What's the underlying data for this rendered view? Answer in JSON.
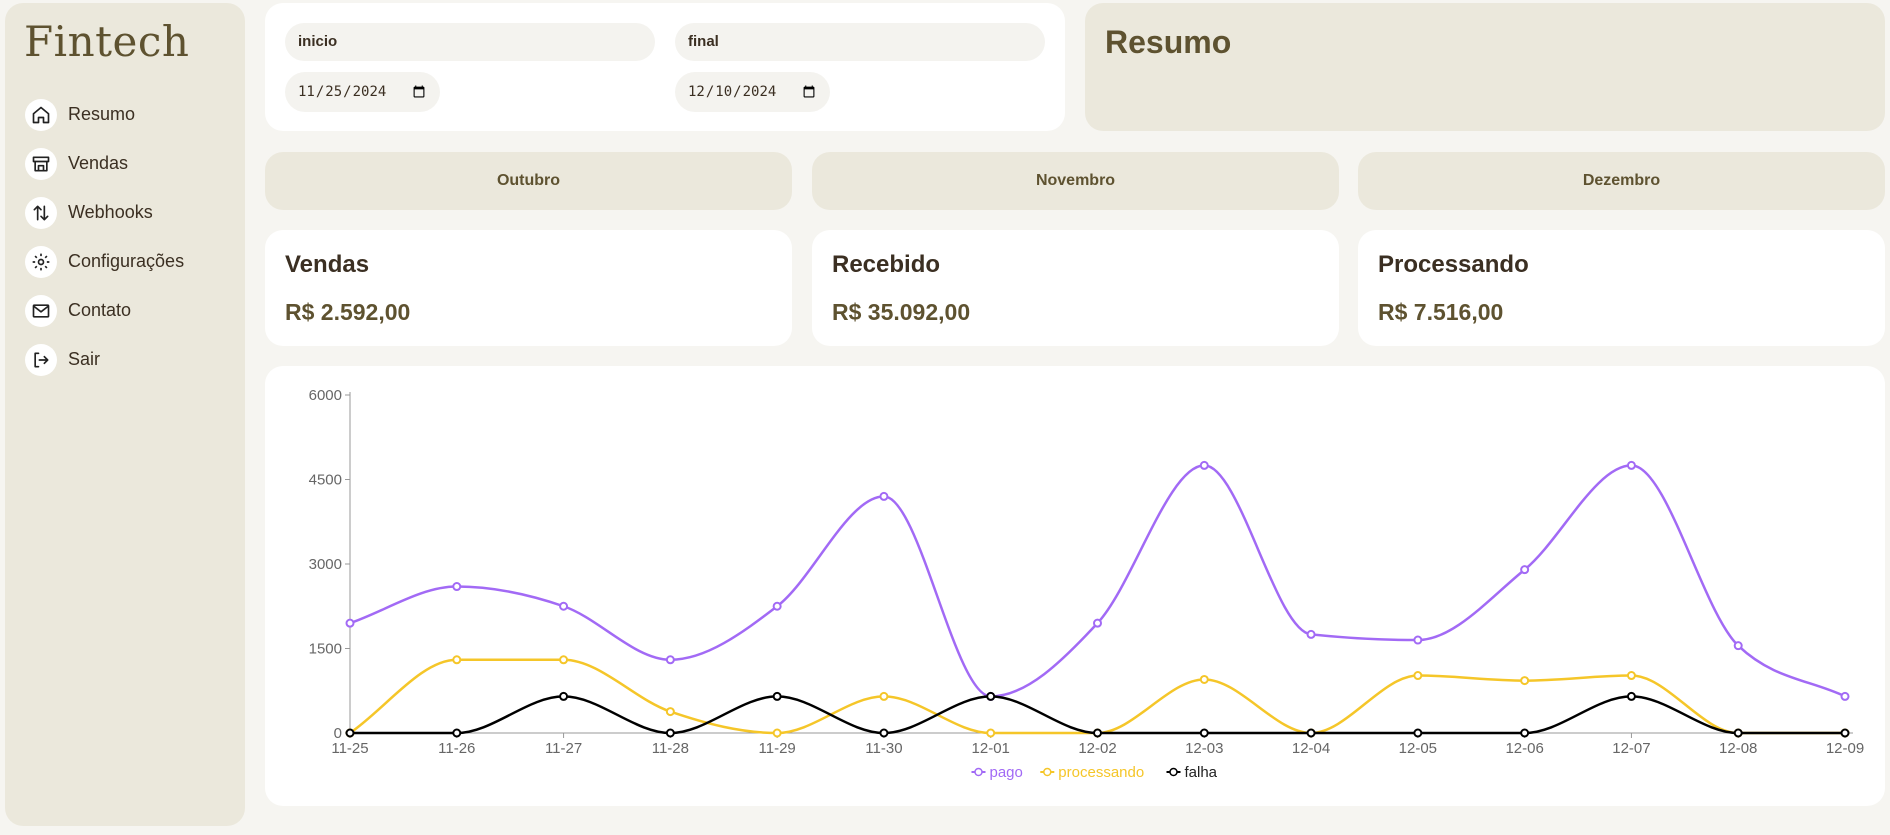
{
  "app": {
    "logo": "Fintech"
  },
  "sidebar": {
    "items": [
      {
        "label": "Resumo",
        "icon": "home-icon"
      },
      {
        "label": "Vendas",
        "icon": "store-icon"
      },
      {
        "label": "Webhooks",
        "icon": "arrows-up-down-icon"
      },
      {
        "label": "Configurações",
        "icon": "gear-icon"
      },
      {
        "label": "Contato",
        "icon": "mail-icon"
      },
      {
        "label": "Sair",
        "icon": "logout-icon"
      }
    ]
  },
  "filters": {
    "start": {
      "label": "inicio",
      "value": "2024-11-25",
      "display": "25/11/2024"
    },
    "end": {
      "label": "final",
      "value": "2024-12-10",
      "display": "10/12/2024"
    }
  },
  "summary": {
    "title": "Resumo"
  },
  "months": [
    "Outubro",
    "Novembro",
    "Dezembro"
  ],
  "stats": [
    {
      "title": "Vendas",
      "value": "R$ 2.592,00"
    },
    {
      "title": "Recebido",
      "value": "R$ 35.092,00"
    },
    {
      "title": "Processando",
      "value": "R$ 7.516,00"
    }
  ],
  "colors": {
    "accent": "#5e5230",
    "sidebar_bg": "#ebe8dc",
    "pago": "#a26af5",
    "processando": "#f5c629",
    "falha": "#000000"
  },
  "chart_data": {
    "type": "line",
    "smooth": true,
    "x": [
      "11-25",
      "11-26",
      "11-27",
      "11-28",
      "11-29",
      "11-30",
      "12-01",
      "12-02",
      "12-03",
      "12-04",
      "12-05",
      "12-06",
      "12-07",
      "12-08",
      "12-09"
    ],
    "ylim": [
      0,
      6000
    ],
    "yticks": [
      0,
      1500,
      3000,
      4500,
      6000
    ],
    "legend": "bottom-center",
    "series": [
      {
        "name": "pago",
        "color": "#a26af5",
        "values": [
          1950,
          2600,
          2250,
          1300,
          2250,
          4200,
          650,
          1950,
          4750,
          1750,
          1650,
          2900,
          4750,
          1550,
          650
        ]
      },
      {
        "name": "processando",
        "color": "#f5c629",
        "values": [
          0,
          1300,
          1300,
          380,
          0,
          650,
          0,
          0,
          950,
          0,
          1020,
          930,
          1020,
          0,
          0
        ]
      },
      {
        "name": "falha",
        "color": "#000000",
        "values": [
          0,
          0,
          650,
          0,
          650,
          0,
          650,
          0,
          0,
          0,
          0,
          0,
          650,
          0,
          0
        ]
      }
    ]
  }
}
